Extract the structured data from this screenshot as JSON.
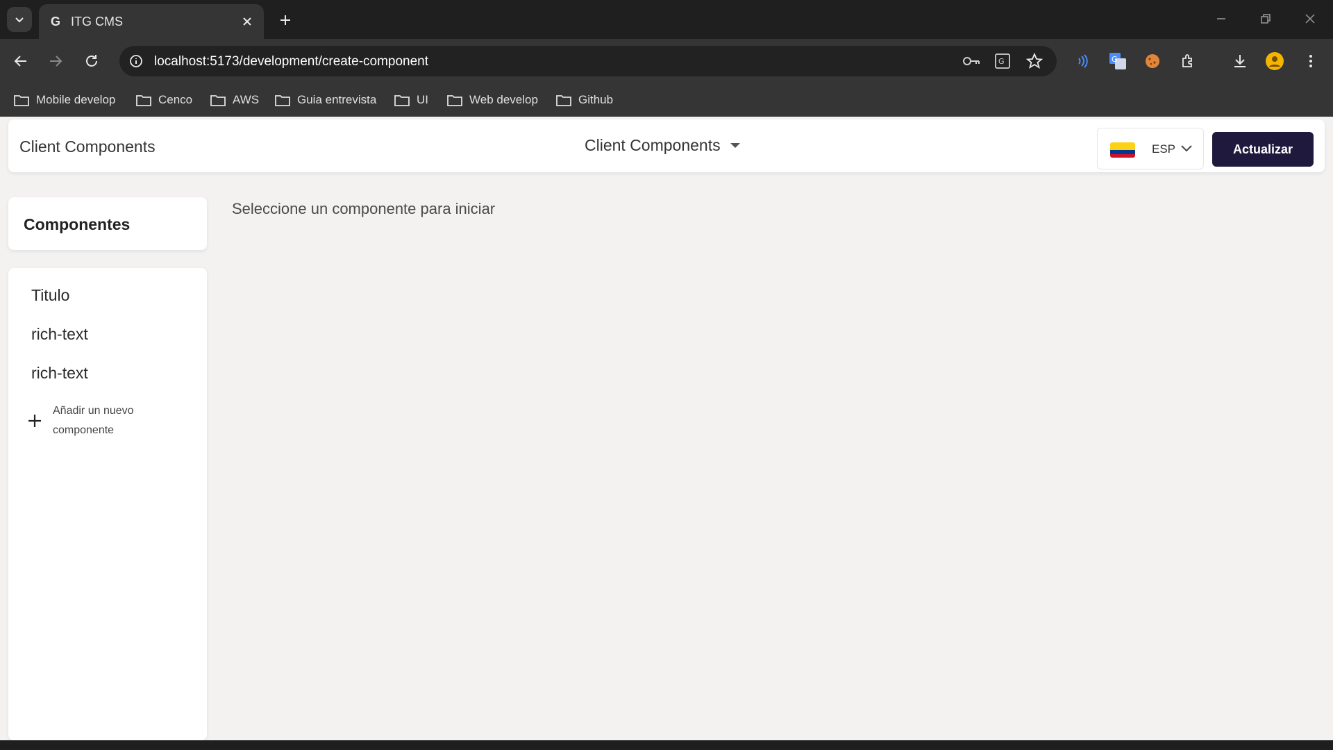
{
  "browser": {
    "tab_title": "ITG CMS",
    "tab_favicon": "G",
    "url": "localhost:5173/development/create-component",
    "bookmarks": [
      {
        "label": "Mobile develop"
      },
      {
        "label": "Cenco"
      },
      {
        "label": "AWS"
      },
      {
        "label": "Guia entrevista"
      },
      {
        "label": "UI"
      },
      {
        "label": "Web develop"
      },
      {
        "label": "Github"
      }
    ]
  },
  "header": {
    "title": "Client Components",
    "project_dropdown": "Client Components",
    "language": "ESP",
    "update_button": "Actualizar"
  },
  "sidebar": {
    "title": "Componentes",
    "items": [
      {
        "label": "Titulo"
      },
      {
        "label": "rich-text"
      },
      {
        "label": "rich-text"
      }
    ],
    "add_label": "Añadir un nuevo componente"
  },
  "main": {
    "empty_message": "Seleccione un componente para iniciar"
  },
  "colors": {
    "accent": "#1f1a3d",
    "flag_yellow": "#fcd116",
    "flag_blue": "#003893",
    "flag_red": "#ce1126"
  }
}
